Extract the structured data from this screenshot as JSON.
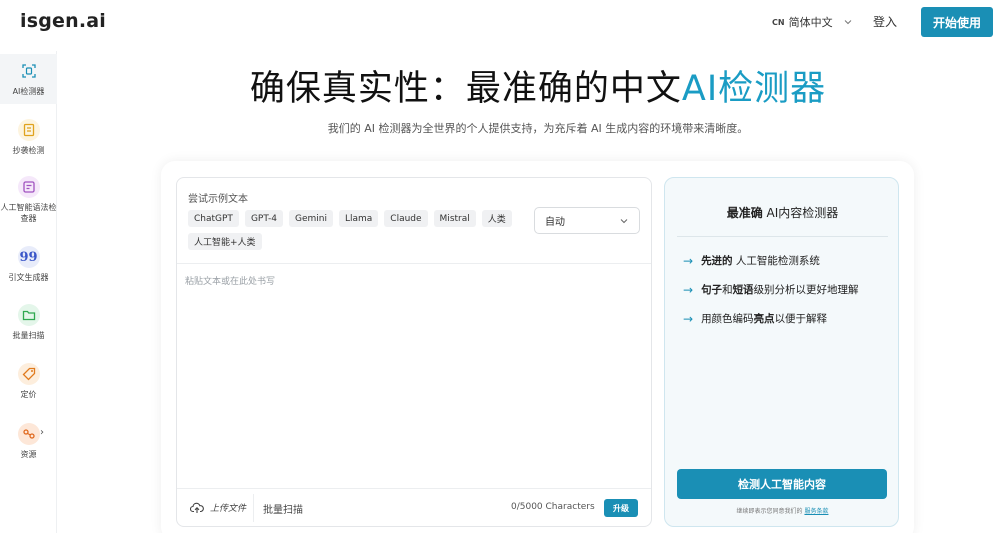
{
  "header": {
    "logo": "isgen.ai",
    "lang_code": "CN",
    "lang_label": "简体中文",
    "login": "登入",
    "start": "开始使用"
  },
  "sidebar": {
    "items": [
      {
        "label": "AI检测器",
        "icon": "ai-detector-icon",
        "color": "#1a8fb5",
        "bg": "#eaf5f9"
      },
      {
        "label": "抄袭检测",
        "icon": "plagiarism-icon",
        "color": "#e0a21d",
        "bg": "#fdf4df"
      },
      {
        "label": "人工智能语法检查器",
        "icon": "grammar-checker-icon",
        "color": "#a052c0",
        "bg": "#f5e8fa"
      },
      {
        "label": "引文生成器",
        "icon": "quote-icon",
        "color": "#3a56c8",
        "bg": "#e8ecfa"
      },
      {
        "label": "批量扫描",
        "icon": "folder-icon",
        "color": "#2ea84f",
        "bg": "#e4f6ea"
      },
      {
        "label": "定价",
        "icon": "price-tag-icon",
        "color": "#e07a1d",
        "bg": "#fdeedd"
      },
      {
        "label": "资源",
        "icon": "resources-icon",
        "color": "#e0681d",
        "bg": "#fde7d8"
      }
    ]
  },
  "hero": {
    "title_main": "确保真实性：最准确的中文",
    "title_accent": "AI检测器",
    "subtitle": "我们的 AI 检测器为全世界的个人提供支持，为充斥着 AI 生成内容的环境带来清晰度。"
  },
  "editor": {
    "sample_label": "尝试示例文本",
    "chips": [
      "ChatGPT",
      "GPT-4",
      "Gemini",
      "Llama",
      "Claude",
      "Mistral",
      "人类",
      "人工智能+人类"
    ],
    "select_value": "自动",
    "placeholder": "粘贴文本或在此处书写",
    "upload_label": "上传文件",
    "batch_label": "批量扫描",
    "counter": "0/5000 Characters",
    "upgrade": "升级"
  },
  "panel": {
    "title_bold": "最准确",
    "title_rest": " AI内容检测器",
    "features": [
      {
        "bold": "先进的",
        "rest": " 人工智能检测系统"
      },
      {
        "bold": "句子",
        "mid": "和",
        "bold2": "短语",
        "rest": "级别分析以更好地理解"
      },
      {
        "pre": "用颜色编码",
        "bold": "亮点",
        "rest": "以便于解释"
      }
    ],
    "detect_button": "检测人工智能内容",
    "terms_text": "继续即表示您同意我们的",
    "terms_link": "服务条款"
  },
  "colors": {
    "accent": "#1a8fb5",
    "title_accent": "#1a9cc4"
  }
}
